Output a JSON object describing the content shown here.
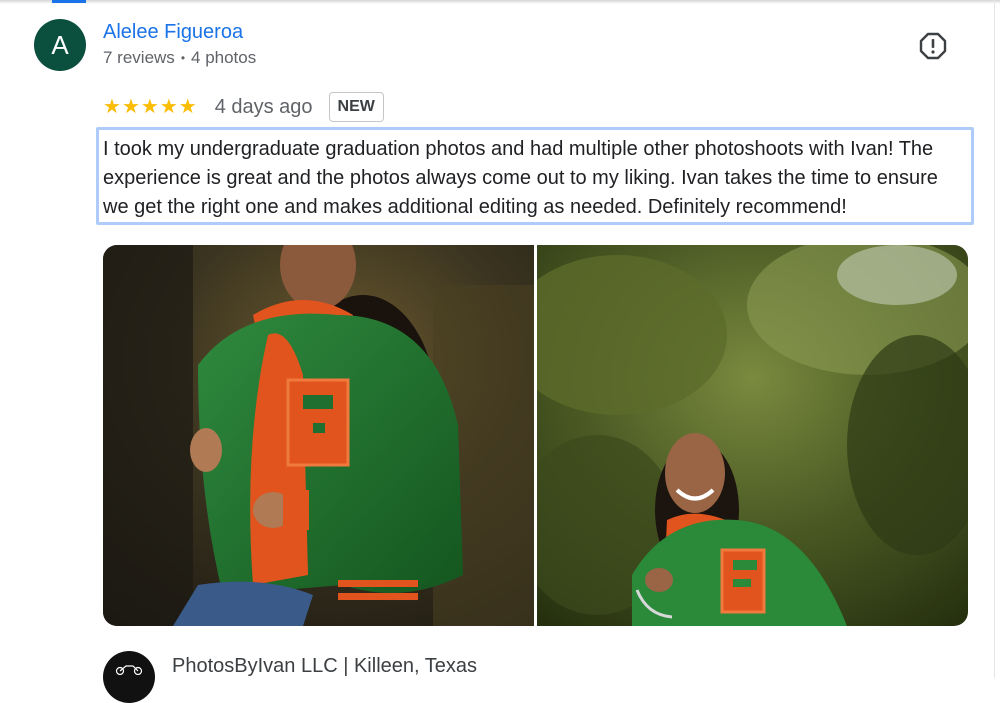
{
  "review": {
    "author": {
      "initial": "A",
      "name": "Alelee Figueroa",
      "reviews_count": "7 reviews",
      "photos_count": "4 photos",
      "avatar_color": "#0b4f3e"
    },
    "rating": 5,
    "stars": [
      "★",
      "★",
      "★",
      "★",
      "★"
    ],
    "date": "4 days ago",
    "badge": "NEW",
    "text": "I took my undergraduate graduation photos and had multiple other photoshoots with Ivan! The experience is great and the photos always come out to my liking. Ivan takes the time to ensure we get the right one and makes additional editing as needed. Definitely recommend!",
    "report_icon": "report-icon",
    "photos": [
      {
        "icon": "photo-young-woman-green-varsity-jacket"
      },
      {
        "icon": "photo-smiling-woman-varsity-jacket-outdoors"
      }
    ]
  },
  "owner_response": {
    "title": "PhotosByIvan LLC | Killeen, Texas",
    "avatar_icon": "business-logo-icon"
  },
  "colors": {
    "link": "#1a73e8",
    "star": "#fbbc04",
    "focus_outline": "#aecbfa",
    "secondary_text": "#5f6368"
  }
}
